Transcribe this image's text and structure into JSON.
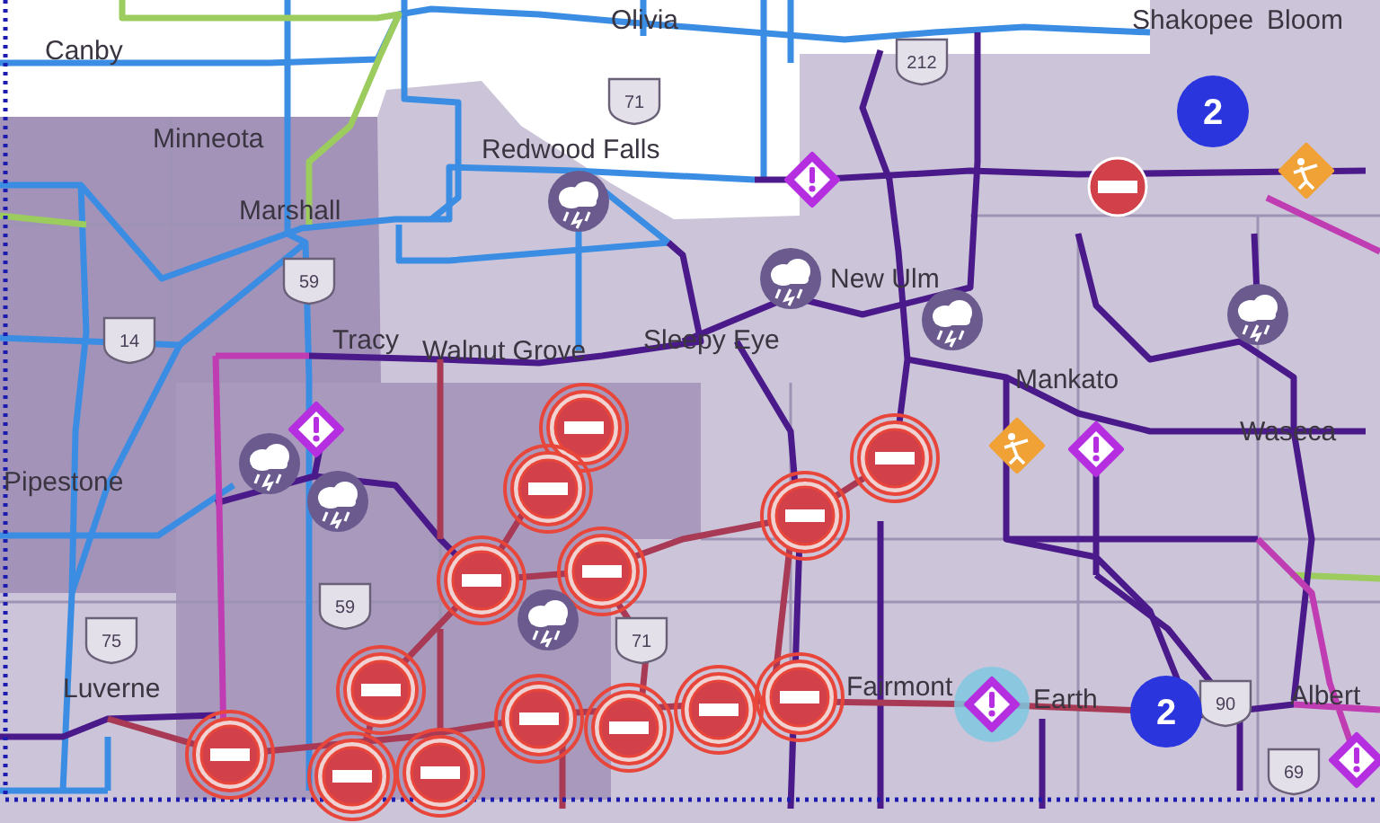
{
  "map": {
    "places": [
      "Olivia",
      "Shakopee",
      "Bloom",
      "Canby",
      "Minneota",
      "Redwood Falls",
      "Marshall",
      "New Ulm",
      "Tracy",
      "Walnut Grove",
      "Sleepy Eye",
      "Mankato",
      "Waseca",
      "Pipestone",
      "Luverne",
      "Fairmont",
      "Earth",
      "Albert"
    ],
    "route_shields": [
      "71",
      "212",
      "59",
      "14",
      "75",
      "59",
      "71",
      "90",
      "69"
    ],
    "markers": [
      {
        "kind": "cluster",
        "count": "2"
      },
      {
        "kind": "storm"
      },
      {
        "kind": "warning",
        "highlighted": false
      },
      {
        "kind": "construction"
      },
      {
        "kind": "closure",
        "highlighted": false
      },
      {
        "kind": "storm"
      },
      {
        "kind": "storm"
      },
      {
        "kind": "storm"
      },
      {
        "kind": "closure",
        "highlighted": true
      },
      {
        "kind": "warning",
        "highlighted": false
      },
      {
        "kind": "construction"
      },
      {
        "kind": "warning",
        "highlighted": false
      },
      {
        "kind": "closure",
        "highlighted": true
      },
      {
        "kind": "storm"
      },
      {
        "kind": "closure",
        "highlighted": true
      },
      {
        "kind": "storm"
      },
      {
        "kind": "closure",
        "highlighted": true
      },
      {
        "kind": "closure",
        "highlighted": true
      },
      {
        "kind": "closure",
        "highlighted": true
      },
      {
        "kind": "storm"
      },
      {
        "kind": "closure",
        "highlighted": true
      },
      {
        "kind": "warning",
        "highlighted": true
      },
      {
        "kind": "closure",
        "highlighted": true
      },
      {
        "kind": "closure",
        "highlighted": true
      },
      {
        "kind": "cluster",
        "count": "2"
      },
      {
        "kind": "closure",
        "highlighted": true
      },
      {
        "kind": "closure",
        "highlighted": true
      },
      {
        "kind": "closure",
        "highlighted": true
      },
      {
        "kind": "warning",
        "highlighted": false
      },
      {
        "kind": "closure",
        "highlighted": true
      },
      {
        "kind": "closure",
        "highlighted": true
      }
    ]
  }
}
